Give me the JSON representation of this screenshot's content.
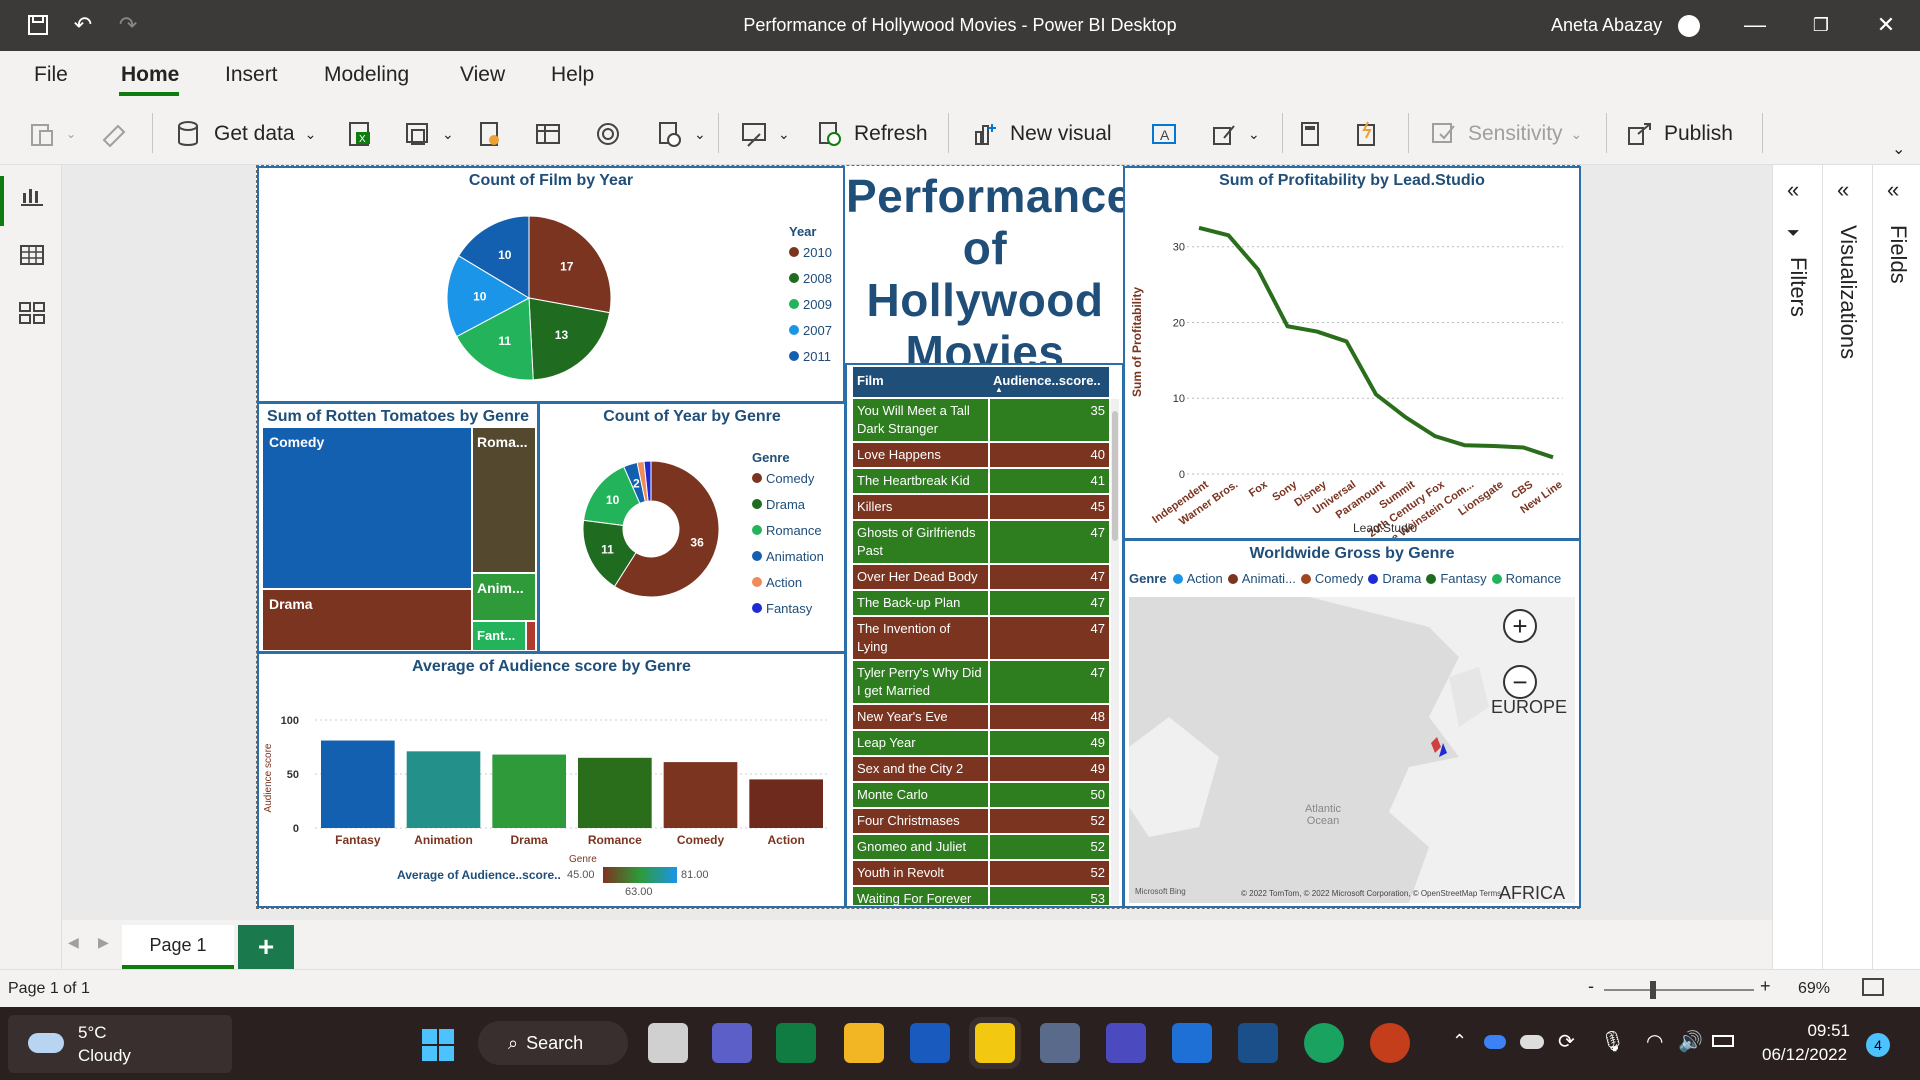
{
  "window": {
    "title": "Performance of Hollywood Movies - Power BI Desktop",
    "user": "Aneta Abazay"
  },
  "menu": [
    "File",
    "Home",
    "Insert",
    "Modeling",
    "View",
    "Help"
  ],
  "ribbon": {
    "get_data": "Get data",
    "refresh": "Refresh",
    "new_visual": "New visual",
    "sensitivity": "Sensitivity",
    "publish": "Publish"
  },
  "panes": {
    "filters": "Filters",
    "visualizations": "Visualizations",
    "fields": "Fields"
  },
  "report_title": "Performance of Hollywood Movies",
  "pie": {
    "title": "Count of Film by Year",
    "legend_title": "Year",
    "legend": [
      {
        "label": "2010",
        "color": "#7b3420"
      },
      {
        "label": "2008",
        "color": "#1f6b1f"
      },
      {
        "label": "2009",
        "color": "#23b35a"
      },
      {
        "label": "2007",
        "color": "#1b95e8"
      },
      {
        "label": "2011",
        "color": "#1460b0"
      }
    ]
  },
  "treemap": {
    "title": "Sum of Rotten Tomatoes by Genre",
    "labels": {
      "comedy": "Comedy",
      "drama": "Drama",
      "romance": "Roma...",
      "animation": "Anim...",
      "fantasy": "Fant..."
    }
  },
  "donut": {
    "title": "Count of Year by Genre",
    "legend_title": "Genre",
    "legend": [
      {
        "label": "Comedy",
        "color": "#7b3420"
      },
      {
        "label": "Drama",
        "color": "#1f6b1f"
      },
      {
        "label": "Romance",
        "color": "#23b35a"
      },
      {
        "label": "Animation",
        "color": "#1460b0"
      },
      {
        "label": "Action",
        "color": "#f08c5a"
      },
      {
        "label": "Fantasy",
        "color": "#1d2ad6"
      }
    ]
  },
  "bars": {
    "title": "Average of Audience score by Genre",
    "ylabel": "Audience score",
    "xlabel": "Genre",
    "gradient_label": "Average of Audience..score..",
    "gradient_min": "45.00",
    "gradient_mid": "63.00",
    "gradient_max": "81.00"
  },
  "table": {
    "col_film": "Film",
    "col_score": "Audience..score..",
    "rows": [
      {
        "film": "You Will Meet a Tall Dark Stranger",
        "score": "35",
        "color": "#2e7d1f"
      },
      {
        "film": "Love Happens",
        "score": "40",
        "color": "#7b3420"
      },
      {
        "film": "The Heartbreak Kid",
        "score": "41",
        "color": "#2e7d1f"
      },
      {
        "film": "Killers",
        "score": "45",
        "color": "#7b3420"
      },
      {
        "film": "Ghosts of Girlfriends Past",
        "score": "47",
        "color": "#2e7d1f"
      },
      {
        "film": "Over Her Dead Body",
        "score": "47",
        "color": "#7b3420"
      },
      {
        "film": "The Back-up Plan",
        "score": "47",
        "color": "#2e7d1f"
      },
      {
        "film": "The Invention of Lying",
        "score": "47",
        "color": "#7b3420"
      },
      {
        "film": "Tyler Perry's Why Did I get Married",
        "score": "47",
        "color": "#2e7d1f"
      },
      {
        "film": "New Year's Eve",
        "score": "48",
        "color": "#7b3420"
      },
      {
        "film": "Leap Year",
        "score": "49",
        "color": "#2e7d1f"
      },
      {
        "film": "Sex and the City 2",
        "score": "49",
        "color": "#7b3420"
      },
      {
        "film": "Monte Carlo",
        "score": "50",
        "color": "#2e7d1f"
      },
      {
        "film": "Four Christmases",
        "score": "52",
        "color": "#7b3420"
      },
      {
        "film": "Gnomeo and Juliet",
        "score": "52",
        "color": "#2e7d1f"
      },
      {
        "film": "Youth in Revolt",
        "score": "52",
        "color": "#7b3420"
      },
      {
        "film": "Waiting For Forever",
        "score": "53",
        "color": "#2e7d1f"
      }
    ]
  },
  "line": {
    "title": "Sum of Profitability by Lead.Studio",
    "xlabel": "Lead.Studio",
    "ylabel": "Sum of Profitability"
  },
  "map": {
    "title": "Worldwide Gross by Genre",
    "legend_title": "Genre",
    "legend": [
      {
        "label": "Action",
        "color": "#1b95e8"
      },
      {
        "label": "Animati...",
        "color": "#7b3420"
      },
      {
        "label": "Comedy",
        "color": "#a0461e"
      },
      {
        "label": "Drama",
        "color": "#1d2ad6"
      },
      {
        "label": "Fantasy",
        "color": "#1f6b1f"
      },
      {
        "label": "Romance",
        "color": "#23b35a"
      }
    ],
    "europe": "EUROPE",
    "ocean": "Atlantic Ocean",
    "africa": "AFRICA",
    "bing": "Microsoft Bing",
    "copyright": "© 2022 TomTom, © 2022 Microsoft Corporation, © OpenStreetMap Terms"
  },
  "pages": {
    "tab": "Page 1",
    "add": "+"
  },
  "status": {
    "page": "Page 1 of 1",
    "zoom": "69%"
  },
  "taskbar": {
    "temp": "5°C",
    "weather": "Cloudy",
    "search": "Search",
    "time": "09:51",
    "date": "06/12/2022",
    "badge": "4"
  },
  "chart_data": [
    {
      "type": "pie",
      "title": "Count of Film by Year",
      "categories": [
        "2010",
        "2008",
        "2009",
        "2007",
        "2011"
      ],
      "values": [
        17,
        13,
        11,
        10,
        10
      ]
    },
    {
      "type": "heatmap",
      "title": "Sum of Rotten Tomatoes by Genre",
      "categories": [
        "Comedy",
        "Drama",
        "Romance",
        "Animation",
        "Fantasy"
      ]
    },
    {
      "type": "pie",
      "title": "Count of Year by Genre",
      "categories": [
        "Comedy",
        "Drama",
        "Romance",
        "Animation",
        "Action",
        "Fantasy"
      ],
      "values": [
        36,
        11,
        10,
        2,
        1,
        1
      ]
    },
    {
      "type": "bar",
      "title": "Average of Audience score by Genre",
      "categories": [
        "Fantasy",
        "Animation",
        "Drama",
        "Romance",
        "Comedy",
        "Action"
      ],
      "values": [
        81,
        71,
        68,
        65,
        61,
        45
      ],
      "ylim": [
        0,
        100
      ],
      "yticks": [
        "100",
        "50",
        "0"
      ],
      "colors": [
        "#1460b0",
        "#24908a",
        "#2e9a3a",
        "#2a6e1c",
        "#7b3420",
        "#6e2a1c"
      ],
      "xlabel": "Genre",
      "ylabel": "Audience score"
    },
    {
      "type": "line",
      "title": "Sum of Profitability by Lead.Studio",
      "categories": [
        "Independent",
        "Warner Bros.",
        "Fox",
        "Sony",
        "Disney",
        "Universal",
        "Paramount",
        "Summit",
        "20th Century Fox",
        "The Weinstein Com...",
        "Lionsgate",
        "CBS",
        "New Line"
      ],
      "values": [
        32.5,
        31.5,
        27,
        19.5,
        18.8,
        17.5,
        10.5,
        7.5,
        5,
        3.8,
        3.7,
        3.5,
        2.2
      ],
      "ylim": [
        0,
        33
      ],
      "yticks": [
        "30",
        "20",
        "10",
        "0"
      ],
      "xlabel": "Lead.Studio",
      "ylabel": "Sum of Profitability"
    }
  ]
}
